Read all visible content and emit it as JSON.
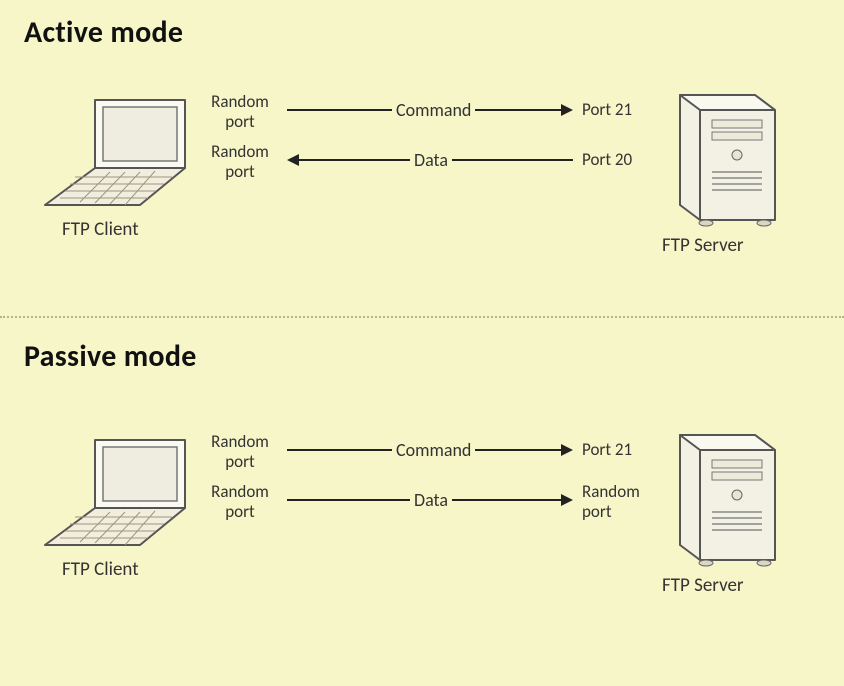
{
  "active": {
    "title": "Active mode",
    "client_caption": "FTP Client",
    "server_caption": "FTP Server",
    "cmd_port_left": "Random port",
    "data_port_left": "Random port",
    "cmd_port_right": "Port 21",
    "data_port_right": "Port 20",
    "cmd_label": "Command",
    "data_label": "Data"
  },
  "passive": {
    "title": "Passive mode",
    "client_caption": "FTP Client",
    "server_caption": "FTP Server",
    "cmd_port_left": "Random port",
    "data_port_left": "Random port",
    "cmd_port_right": "Port 21",
    "data_port_right": "Random port",
    "cmd_label": "Command",
    "data_label": "Data"
  }
}
